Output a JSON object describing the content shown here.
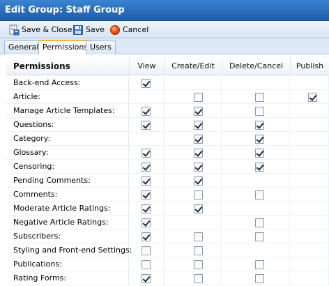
{
  "window": {
    "title": "Edit Group: Staff Group"
  },
  "toolbar": {
    "save_close_label": "Save & Close",
    "save_label": "Save",
    "cancel_label": "Cancel"
  },
  "tabs": [
    {
      "label": "General",
      "active": false
    },
    {
      "label": "Permissions",
      "active": true
    },
    {
      "label": "Users",
      "active": false
    }
  ],
  "grid": {
    "header": {
      "name": "Permissions",
      "view": "View",
      "create_edit": "Create/Edit",
      "delete_cancel": "Delete/Cancel",
      "publish": "Publish"
    },
    "rows": [
      {
        "label": "Back-end Access:",
        "view": "checked",
        "create": "none",
        "delete": "none",
        "publish": "none"
      },
      {
        "label": "Article:",
        "view": "none",
        "create": "unchecked",
        "delete": "unchecked",
        "publish": "checked"
      },
      {
        "label": "Manage Article Templates:",
        "view": "checked",
        "create": "checked",
        "delete": "unchecked",
        "publish": "none"
      },
      {
        "label": "Questions:",
        "view": "checked",
        "create": "checked",
        "delete": "checked",
        "publish": "none"
      },
      {
        "label": "Category:",
        "view": "none",
        "create": "checked",
        "delete": "checked",
        "publish": "none"
      },
      {
        "label": "Glossary:",
        "view": "checked",
        "create": "checked",
        "delete": "checked",
        "publish": "none"
      },
      {
        "label": "Censoring:",
        "view": "checked",
        "create": "checked",
        "delete": "checked",
        "publish": "none"
      },
      {
        "label": "Pending Comments:",
        "view": "checked",
        "create": "checked",
        "delete": "none",
        "publish": "none"
      },
      {
        "label": "Comments:",
        "view": "checked",
        "create": "unchecked",
        "delete": "unchecked",
        "publish": "none"
      },
      {
        "label": "Moderate Article Ratings:",
        "view": "checked",
        "create": "checked",
        "delete": "none",
        "publish": "none"
      },
      {
        "label": "Negative Article Ratings:",
        "view": "checked",
        "create": "none",
        "delete": "unchecked",
        "publish": "none"
      },
      {
        "label": "Subscribers:",
        "view": "checked",
        "create": "unchecked",
        "delete": "unchecked",
        "publish": "none"
      },
      {
        "label": "Styling and Front-end Settings:",
        "view": "unchecked",
        "create": "unchecked",
        "delete": "none",
        "publish": "none"
      },
      {
        "label": "Publications:",
        "view": "unchecked",
        "create": "unchecked",
        "delete": "unchecked",
        "publish": "none"
      },
      {
        "label": "Rating Forms:",
        "view": "checked",
        "create": "unchecked",
        "delete": "unchecked",
        "publish": "none"
      }
    ]
  },
  "colors": {
    "titlebar": "#2b6fbf",
    "toolbar": "#dfe9f5",
    "active_tab_accent": "#f0b740"
  },
  "icons": {
    "save_close": "save-close-icon",
    "save": "floppy-disk-icon",
    "cancel": "cancel-circle-icon"
  }
}
